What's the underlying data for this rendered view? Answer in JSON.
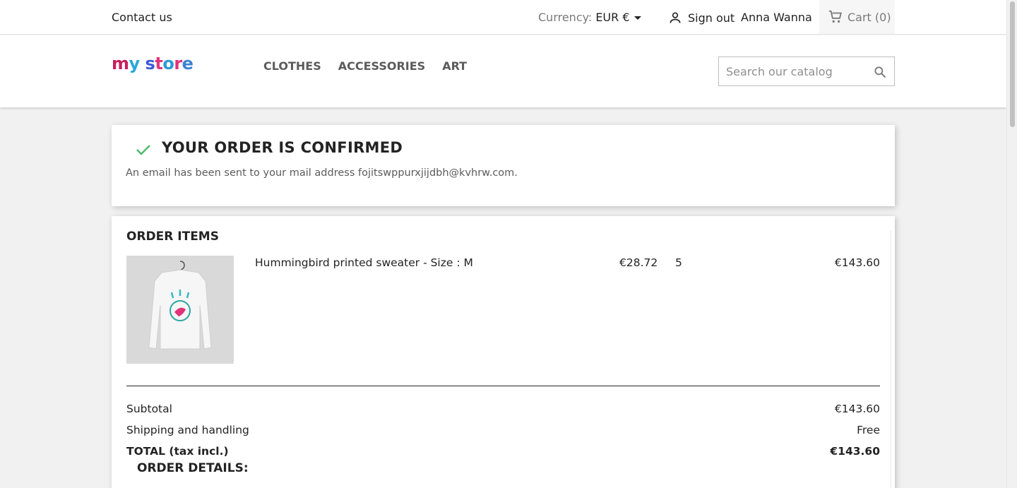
{
  "topbar": {
    "contact": "Contact us",
    "currency_label": "Currency:",
    "currency_value": "EUR €",
    "signout": "Sign out",
    "username": "Anna Wanna",
    "cart": "Cart (0)"
  },
  "header": {
    "logo_letters": [
      "m",
      "y",
      " ",
      "s",
      "t",
      "o",
      "r",
      "e"
    ],
    "logo_colors": [
      "#c81e5a",
      "#2aa6dc",
      "#ffffff",
      "#3b59d9",
      "#e0337a",
      "#2a9ad6",
      "#e1307a",
      "#3b82d6"
    ],
    "menu": [
      "CLOTHES",
      "ACCESSORIES",
      "ART"
    ],
    "search_placeholder": "Search our catalog"
  },
  "confirmation": {
    "title": "YOUR ORDER IS CONFIRMED",
    "message": "An email has been sent to your mail address fojitswppurxjijdbh@kvhrw.com."
  },
  "order": {
    "title": "ORDER ITEMS",
    "item": {
      "name": "Hummingbird printed sweater - Size : M",
      "unit_price": "€28.72",
      "quantity": "5",
      "line_total": "€143.60"
    },
    "subtotal_label": "Subtotal",
    "subtotal_value": "€143.60",
    "shipping_label": "Shipping and handling",
    "shipping_value": "Free",
    "total_label": "TOTAL (tax incl.)",
    "total_value": "€143.60",
    "details_title": "ORDER DETAILS:"
  },
  "colors": {
    "check": "#4cbb6c"
  }
}
